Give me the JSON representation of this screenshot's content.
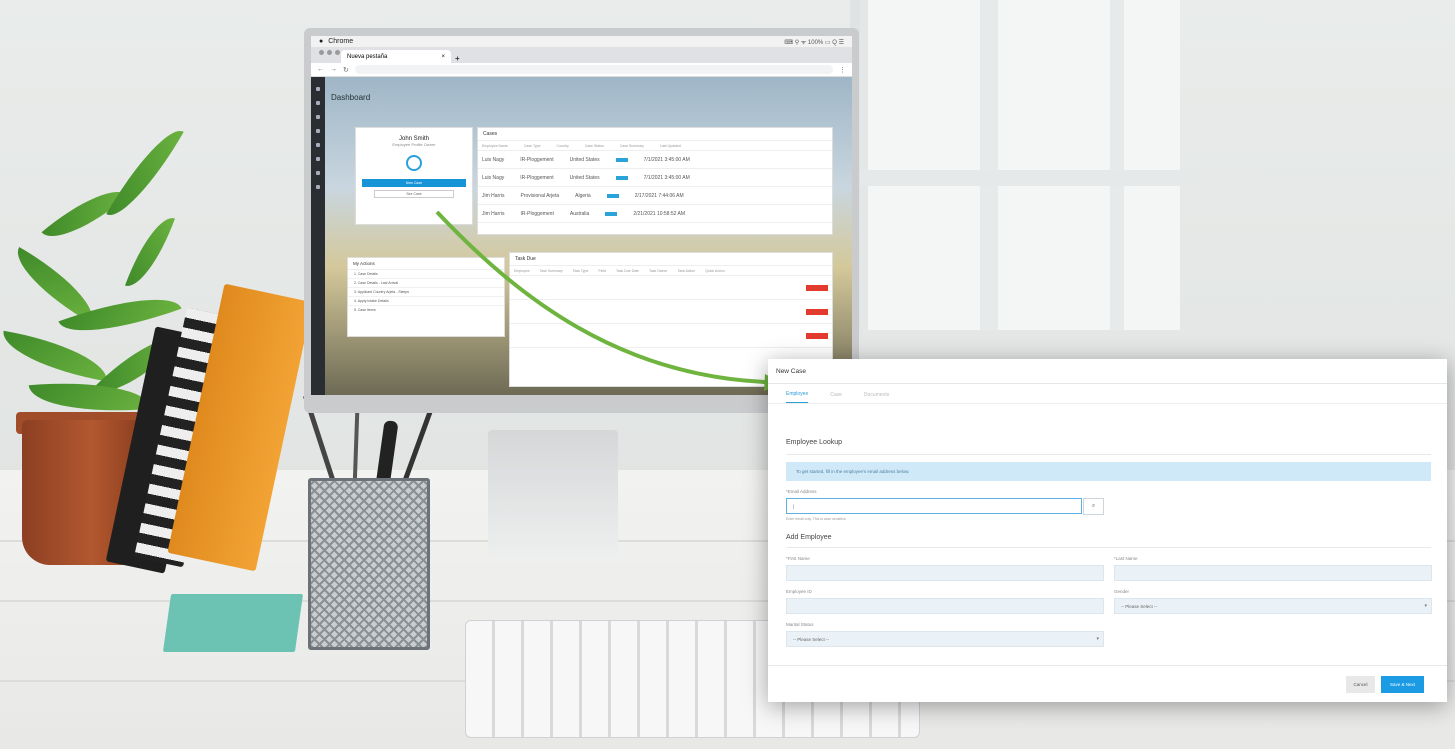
{
  "browser": {
    "app_name": "Chrome",
    "tab_title": "Nueva pestaña",
    "tab_close": "×",
    "tab_new": "+",
    "status_icons": "⌨ ⚲ ᯤ 100% ▭ Q ☰"
  },
  "dashboard": {
    "title": "Dashboard",
    "profile": {
      "name": "John Smith",
      "role": "Employee Profile Owner",
      "primary_button": "New Case",
      "secondary_button": "See Case"
    },
    "cases_panel": {
      "title": "Cases",
      "columns": [
        "Employee Name",
        "Case Type",
        "Country",
        "Case Status",
        "Case Summary",
        "Last Updated"
      ],
      "rows": [
        {
          "name": "Luis Nagy",
          "type": "IR-Ploggement",
          "country": "United States",
          "updated": "7/1/2021 3:45:00 AM"
        },
        {
          "name": "Luis Nagy",
          "type": "IR-Ploggement",
          "country": "United States",
          "updated": "7/1/2021 3:45:00 AM"
        },
        {
          "name": "Jim Harris",
          "type": "Provisional Arjeta",
          "country": "Algeria",
          "updated": "2/17/2021 7:44:06 AM"
        },
        {
          "name": "Jim Harris",
          "type": "IR-Ploggement",
          "country": "Australia",
          "updated": "2/21/2021 10:58:52 AM"
        }
      ]
    },
    "my_items": {
      "title": "My Actions",
      "rows": [
        "1. Case Details",
        "2. Case Details - Last Arrival",
        "3. Applicant Country Arjeta - Sleeps",
        "4. Apply Intake Details",
        "5. Case Items"
      ]
    },
    "tasks_panel": {
      "title": "Task Due",
      "columns": [
        "Employee",
        "Task Summary",
        "Task Type",
        "Field",
        "Task Due Date",
        "Task Owner",
        "Task Action",
        "Quick Action"
      ]
    }
  },
  "modal": {
    "title": "New Case",
    "tabs": [
      "Employee",
      "Case",
      "Documents"
    ],
    "lookup_heading": "Employee Lookup",
    "info_text": "To get started, fill in the employee's email address below.",
    "email_label": "*Email Address",
    "email_value": "|",
    "email_hint": "Enter email only. This is case sensitive.",
    "search_icon": "⌕",
    "add_heading": "Add Employee",
    "first_name_label": "*First Name",
    "last_name_label": "*Last Name",
    "employee_id_label": "Employee ID",
    "gender_label": "Gender",
    "gender_placeholder": "-- Please Select --",
    "marital_label": "Marital Status",
    "marital_placeholder": "-- Please Select --",
    "cancel_label": "Cancel",
    "save_label": "Save & Next"
  }
}
